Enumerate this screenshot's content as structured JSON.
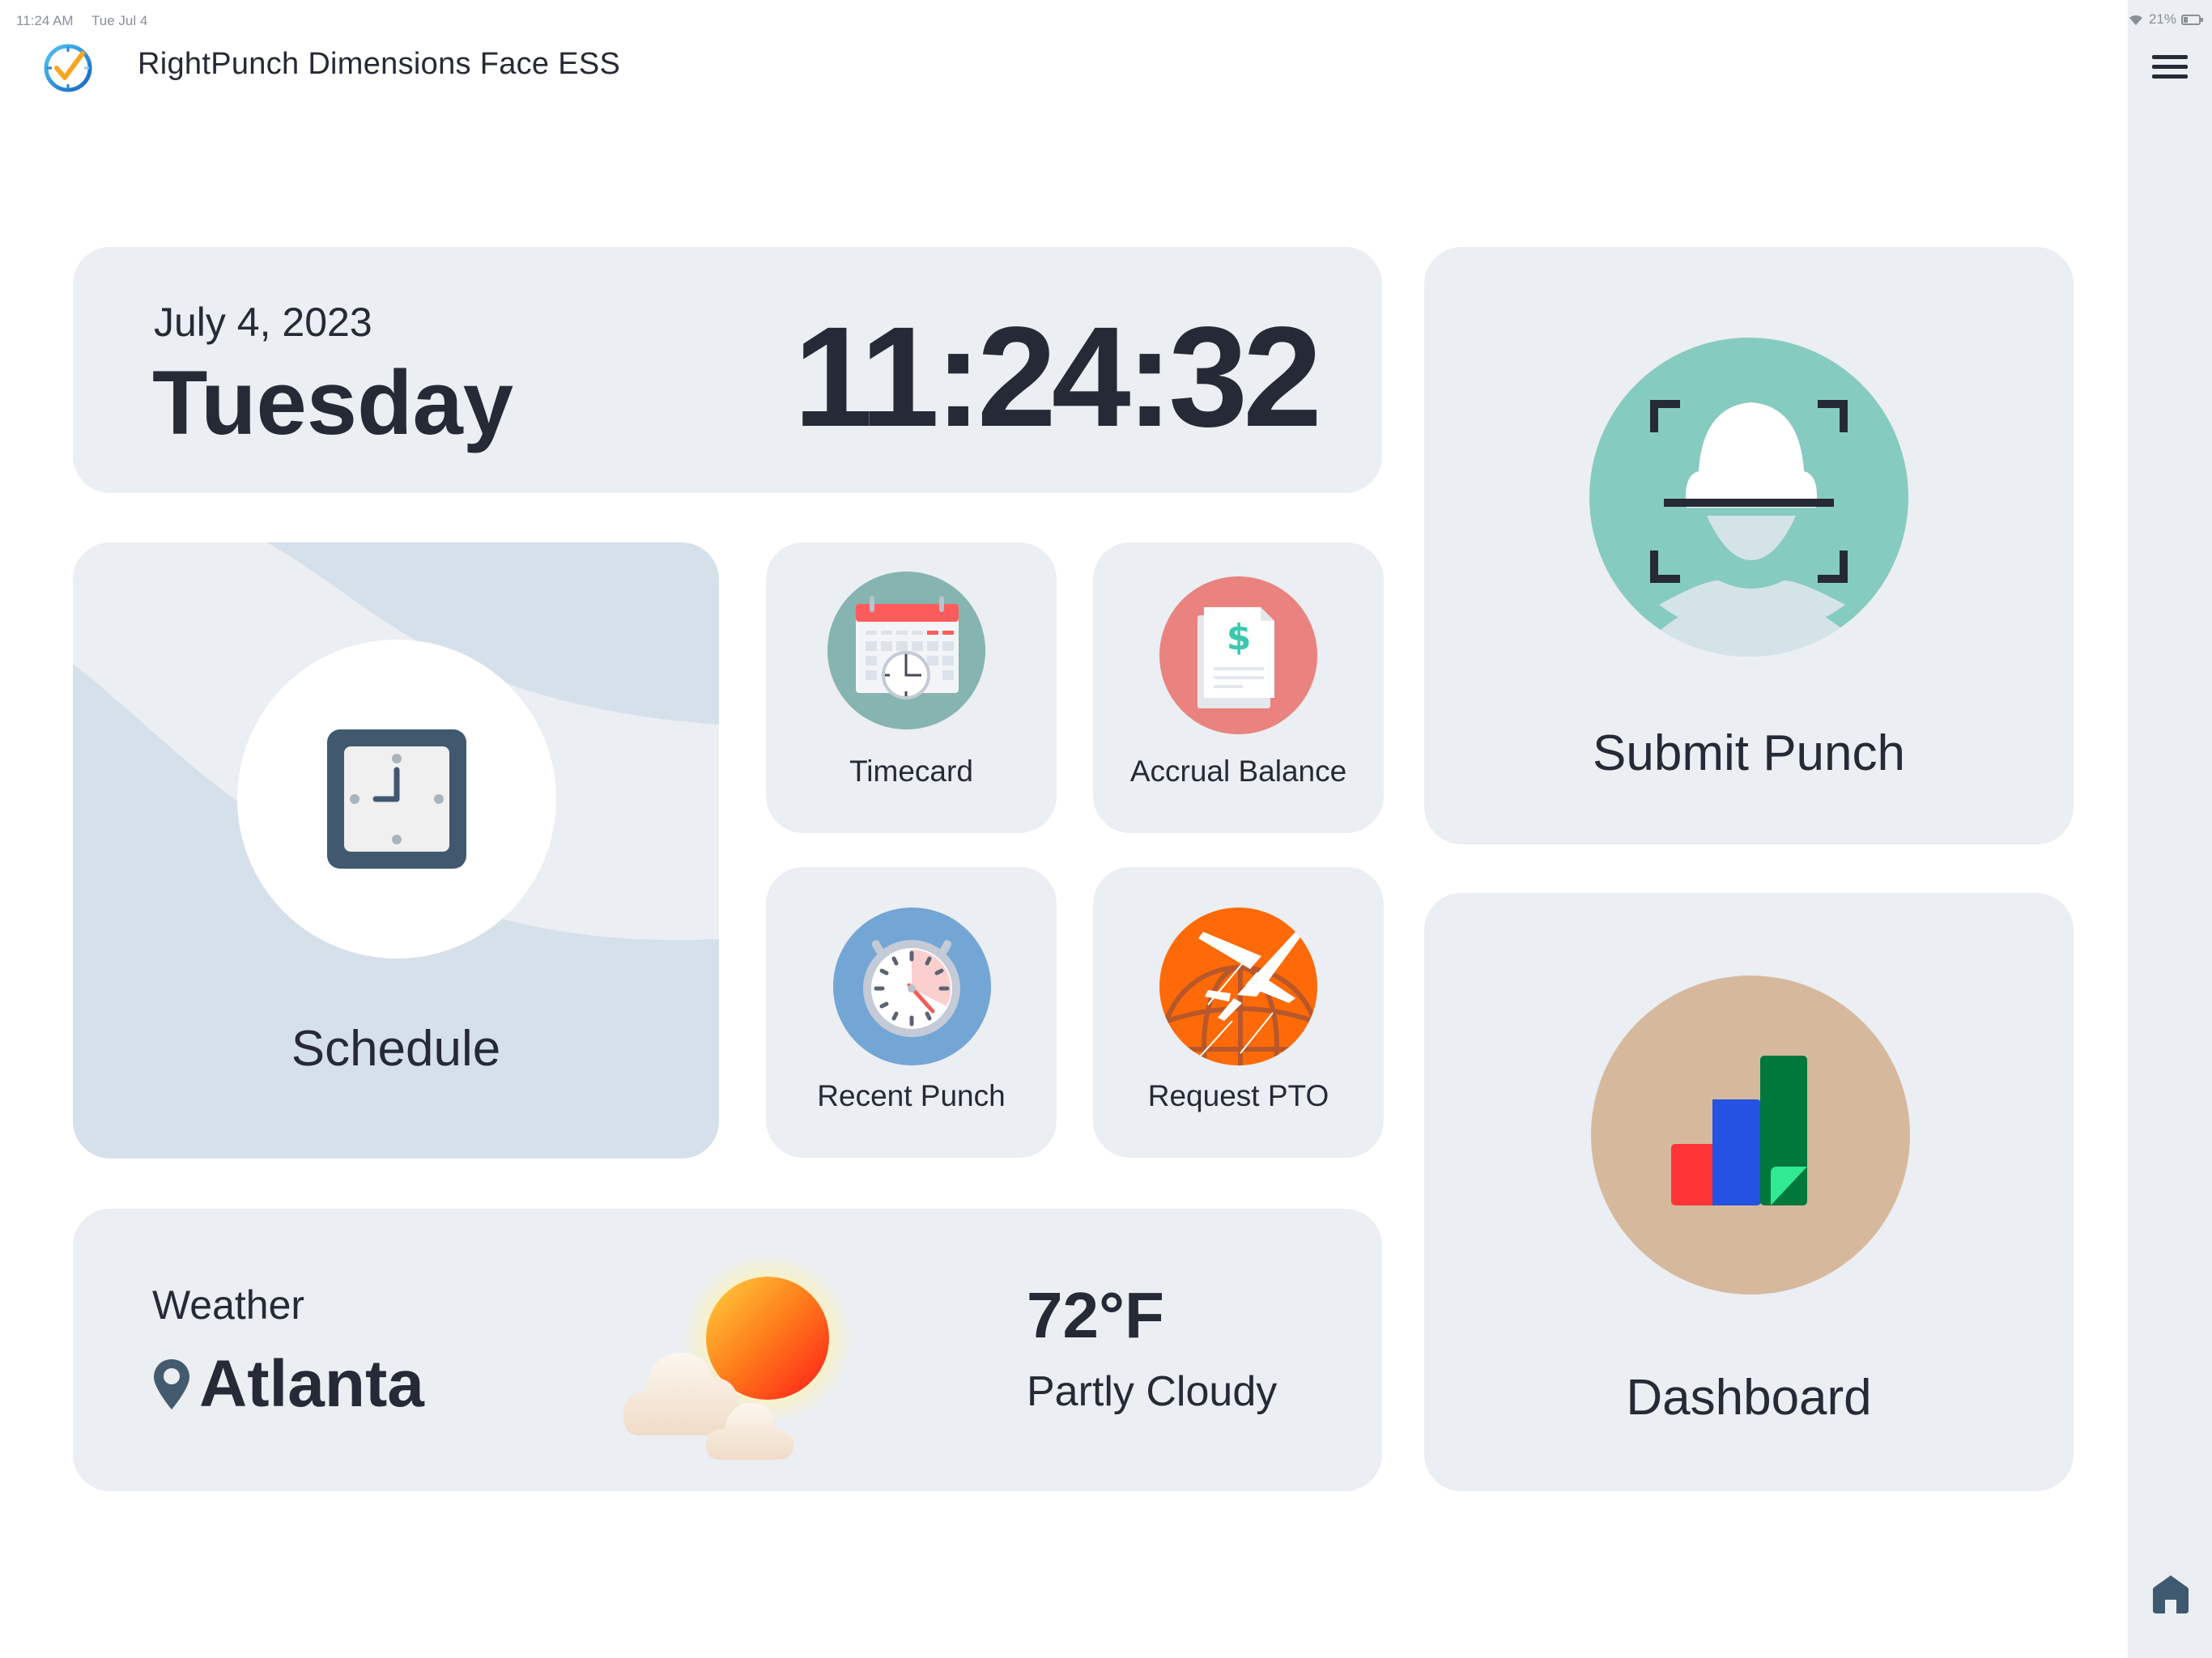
{
  "status_bar": {
    "time": "11:24 AM",
    "date": "Tue Jul 4",
    "battery_percent": "21%",
    "wifi_icon": "wifi-icon",
    "battery_icon": "battery-icon"
  },
  "header": {
    "title": "RightPunch Dimensions Face ESS",
    "logo_icon": "clock-check-icon"
  },
  "sidebar": {
    "menu_icon": "hamburger-menu-icon",
    "home_icon": "home-icon"
  },
  "datetime": {
    "date": "July 4, 2023",
    "weekday": "Tuesday",
    "time": "11:24:32"
  },
  "tiles": {
    "schedule": {
      "label": "Schedule",
      "icon": "wall-clock-icon"
    },
    "timecard": {
      "label": "Timecard",
      "icon": "calendar-clock-icon",
      "color": "#86b4b0"
    },
    "accrual": {
      "label": "Accrual Balance",
      "icon": "invoice-dollar-icon",
      "color": "#ea8380"
    },
    "recent_punch": {
      "label": "Recent Punch",
      "icon": "stopwatch-icon",
      "color": "#73a6d4"
    },
    "request_pto": {
      "label": "Request PTO",
      "icon": "airplane-globe-icon",
      "color": "#fe6a07"
    },
    "submit_punch": {
      "label": "Submit Punch",
      "icon": "face-scan-icon",
      "color": "#86cbbf"
    },
    "dashboard": {
      "label": "Dashboard",
      "icon": "bar-chart-icon",
      "color": "#d6b99d"
    }
  },
  "weather": {
    "label": "Weather",
    "city": "Atlanta",
    "temperature": "72°F",
    "condition": "Partly Cloudy",
    "icon": "partly-cloudy-icon"
  }
}
